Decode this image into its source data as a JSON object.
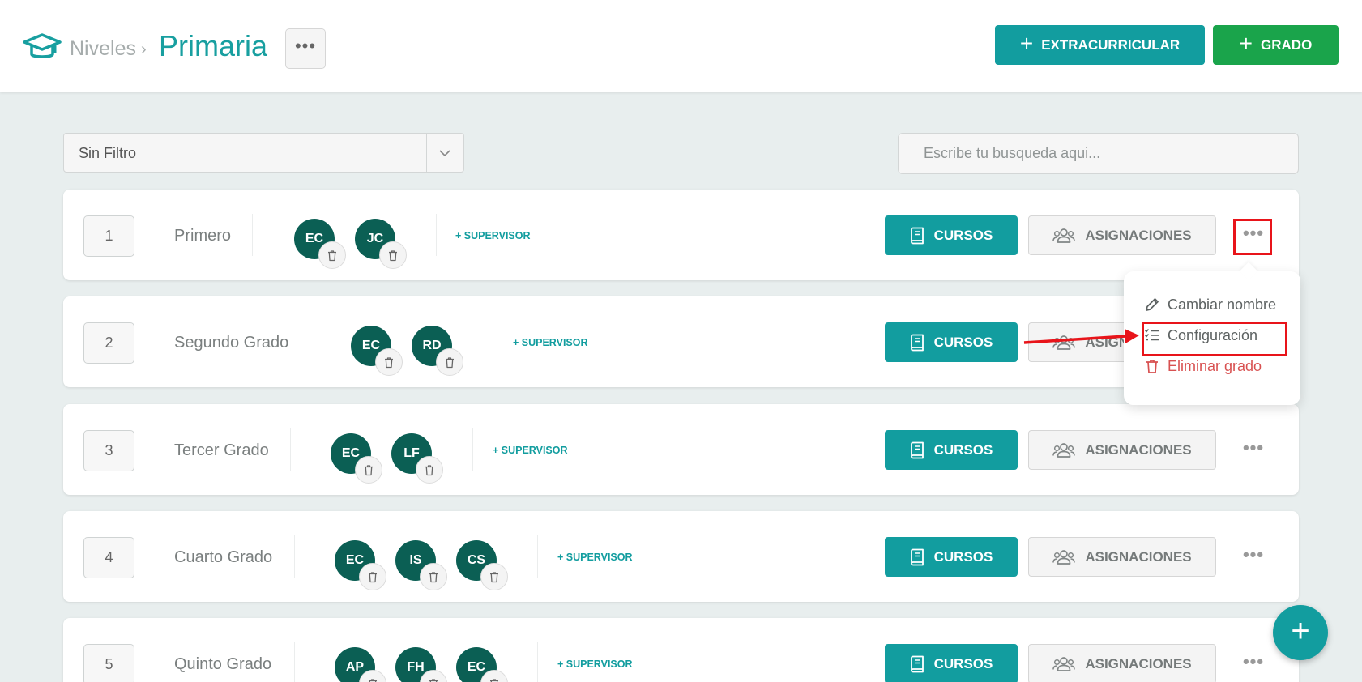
{
  "header": {
    "breadcrumb_root": "Niveles",
    "breadcrumb_sep": "›",
    "title": "Primaria",
    "more_label": "•••",
    "btn_extracurricular": "EXTRACURRICULAR",
    "btn_grado": "GRADO",
    "plus": "+"
  },
  "filters": {
    "select_value": "Sin Filtro",
    "search_placeholder": "Escribe tu busqueda aqui..."
  },
  "row_labels": {
    "supervisor": "+ SUPERVISOR",
    "cursos": "CURSOS",
    "asignaciones": "ASIGNACIONES",
    "more": "•••"
  },
  "grades": [
    {
      "number": "1",
      "name": "Primero",
      "avatars": [
        "EC",
        "JC"
      ]
    },
    {
      "number": "2",
      "name": "Segundo Grado",
      "avatars": [
        "EC",
        "RD"
      ]
    },
    {
      "number": "3",
      "name": "Tercer Grado",
      "avatars": [
        "EC",
        "LF"
      ]
    },
    {
      "number": "4",
      "name": "Cuarto Grado",
      "avatars": [
        "EC",
        "IS",
        "CS"
      ]
    },
    {
      "number": "5",
      "name": "Quinto Grado",
      "avatars": [
        "AP",
        "FH",
        "EC"
      ]
    }
  ],
  "menu": {
    "rename": "Cambiar nombre",
    "config": "Configuración",
    "delete": "Eliminar grado"
  },
  "fab": {
    "label": "+"
  },
  "colors": {
    "teal": "#129d9f",
    "green": "#1aa44b",
    "avatar": "#0b5f54",
    "annotation": "#e8141a",
    "danger": "#d85151"
  },
  "icons": [
    "graduation-cap-icon",
    "chevron-down-icon",
    "book-icon",
    "users-icon",
    "trash-icon",
    "pencil-icon",
    "checklist-icon",
    "plus-icon",
    "more-icon"
  ]
}
